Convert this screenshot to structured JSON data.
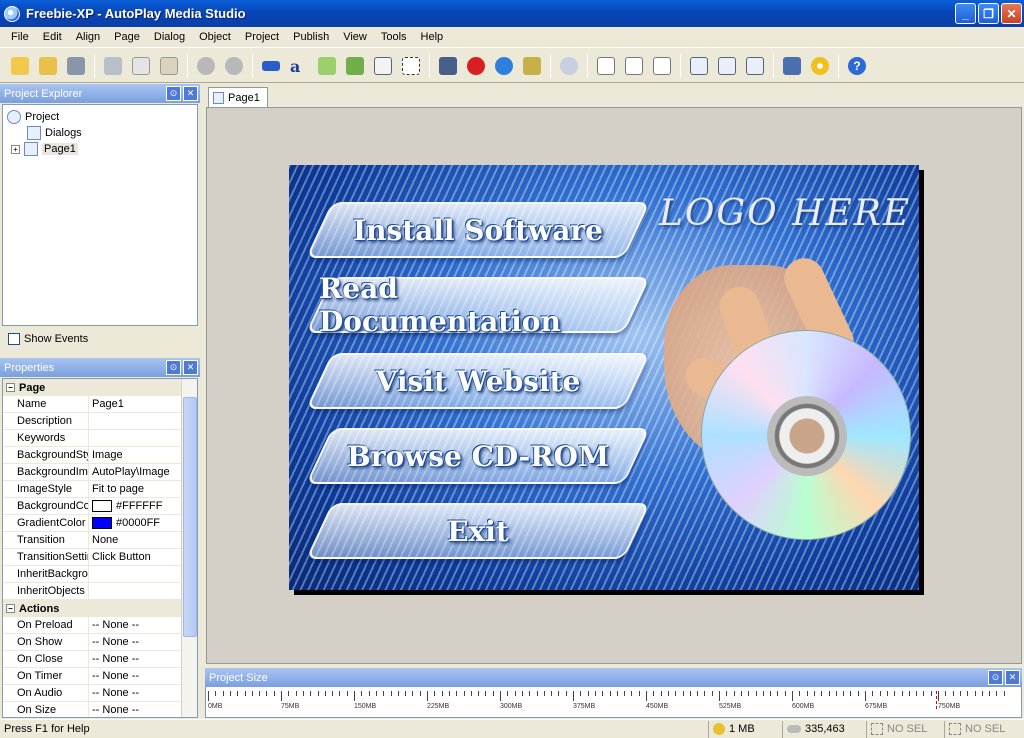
{
  "window": {
    "title": "Freebie-XP - AutoPlay Media Studio"
  },
  "menu": [
    "File",
    "Edit",
    "Align",
    "Page",
    "Dialog",
    "Object",
    "Project",
    "Publish",
    "View",
    "Tools",
    "Help"
  ],
  "project_explorer": {
    "title": "Project Explorer",
    "tree": {
      "root": "Project",
      "dialogs": "Dialogs",
      "page": "Page1"
    },
    "show_events": "Show Events"
  },
  "properties": {
    "title": "Properties",
    "page_category": "Page",
    "rows": [
      {
        "k": "Name",
        "v": "Page1"
      },
      {
        "k": "Description",
        "v": ""
      },
      {
        "k": "Keywords",
        "v": ""
      },
      {
        "k": "BackgroundStyle",
        "v": "Image"
      },
      {
        "k": "BackgroundImage",
        "v": "AutoPlay\\Image"
      },
      {
        "k": "ImageStyle",
        "v": "Fit to page"
      },
      {
        "k": "BackgroundColor",
        "v": "#FFFFFF"
      },
      {
        "k": "GradientColor",
        "v": "#0000FF"
      },
      {
        "k": "Transition",
        "v": "None"
      },
      {
        "k": "TransitionSettings",
        "v": "Click Button"
      },
      {
        "k": "InheritBackground",
        "v": ""
      },
      {
        "k": "InheritObjects",
        "v": ""
      }
    ],
    "actions_category": "Actions",
    "actions": [
      {
        "k": "On Preload",
        "v": "-- None --"
      },
      {
        "k": "On Show",
        "v": "-- None --"
      },
      {
        "k": "On Close",
        "v": "-- None --"
      },
      {
        "k": "On Timer",
        "v": "-- None --"
      },
      {
        "k": "On Audio",
        "v": "-- None --"
      },
      {
        "k": "On Size",
        "v": "-- None --"
      }
    ],
    "colors": {
      "background": "#FFFFFF",
      "gradient": "#0000FF"
    }
  },
  "document_tab": "Page1",
  "canvas": {
    "logo": "LOGO HERE",
    "buttons": [
      "Install Software",
      "Read Documentation",
      "Visit Website",
      "Browse CD-ROM",
      "Exit"
    ]
  },
  "project_size": {
    "title": "Project Size",
    "labels": [
      "0MB",
      "75MB",
      "150MB",
      "225MB",
      "300MB",
      "375MB",
      "450MB",
      "525MB",
      "600MB",
      "675MB",
      "750MB"
    ]
  },
  "status": {
    "help": "Press F1 for Help",
    "size": "1 MB",
    "count": "335,463",
    "sel1": "NO SEL",
    "sel2": "NO SEL"
  }
}
